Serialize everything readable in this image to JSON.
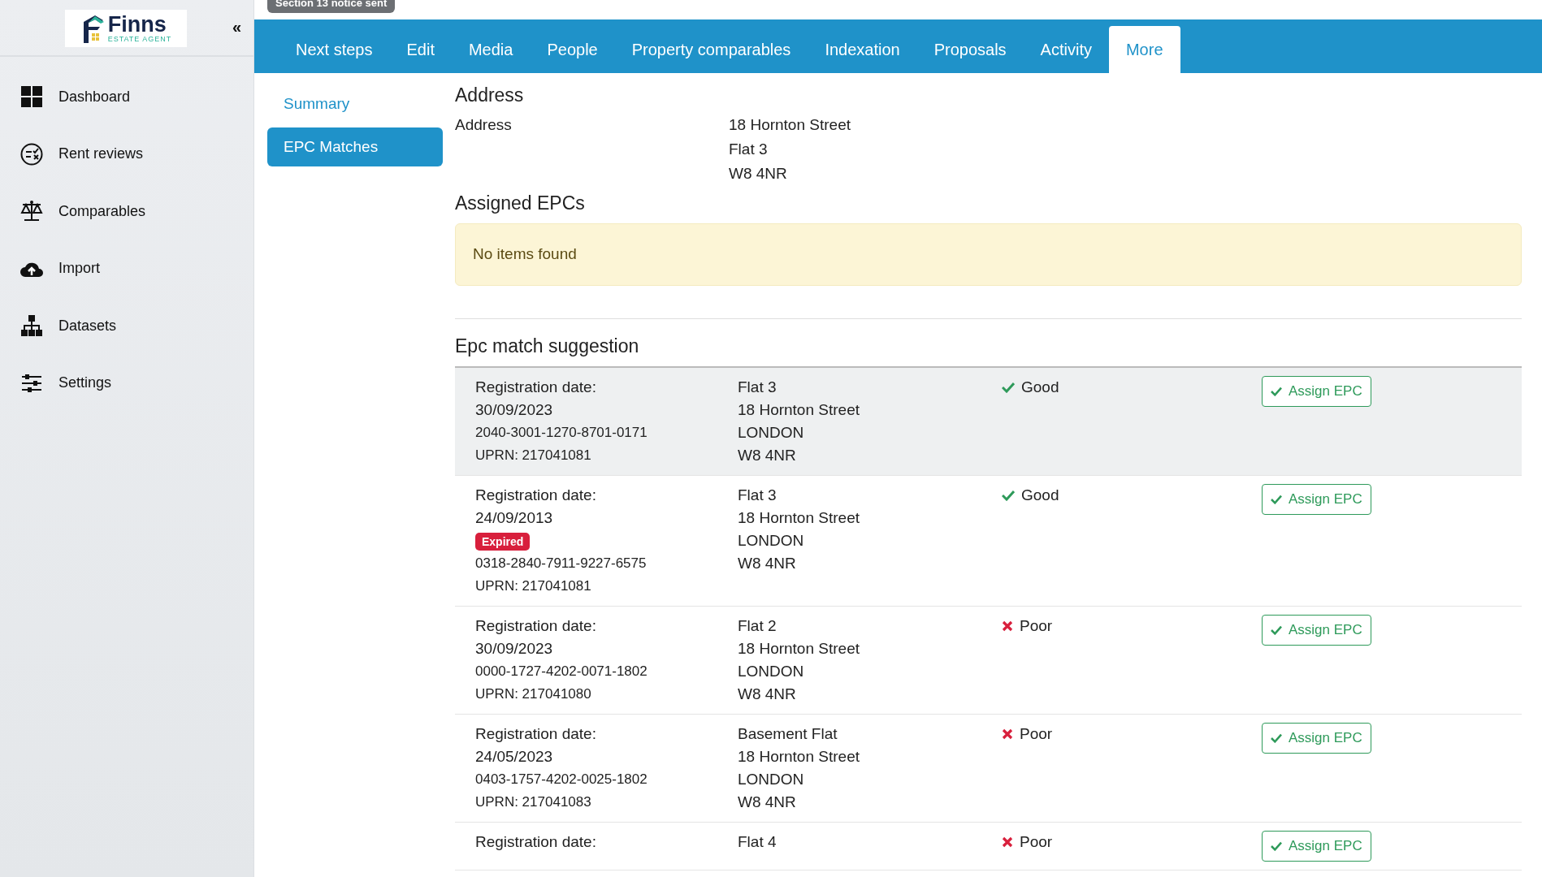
{
  "logo": {
    "name": "Finns",
    "tagline": "ESTATE AGENT"
  },
  "collapse_button": "«",
  "sidebar": {
    "items": [
      {
        "label": "Dashboard"
      },
      {
        "label": "Rent reviews"
      },
      {
        "label": "Comparables"
      },
      {
        "label": "Import"
      },
      {
        "label": "Datasets"
      },
      {
        "label": "Settings"
      }
    ]
  },
  "status_badge": "Section 13 notice sent",
  "tabs": [
    {
      "label": "Next steps",
      "selected": false
    },
    {
      "label": "Edit",
      "selected": false
    },
    {
      "label": "Media",
      "selected": false
    },
    {
      "label": "People",
      "selected": false
    },
    {
      "label": "Property comparables",
      "selected": false
    },
    {
      "label": "Indexation",
      "selected": false
    },
    {
      "label": "Proposals",
      "selected": false
    },
    {
      "label": "Activity",
      "selected": false
    },
    {
      "label": "More",
      "selected": true
    }
  ],
  "subnav": [
    {
      "label": "Summary",
      "selected": false
    },
    {
      "label": "EPC Matches",
      "selected": true
    }
  ],
  "address": {
    "heading": "Address",
    "label": "Address",
    "lines": [
      "18 Hornton Street",
      "Flat 3",
      "W8 4NR"
    ]
  },
  "assigned": {
    "heading": "Assigned EPCs",
    "empty_message": "No items found"
  },
  "suggestions": {
    "heading": "Epc match suggestion",
    "rows": [
      {
        "highlighted": true,
        "date_label": "Registration date:",
        "date": "30/09/2023",
        "certificate": "2040-3001-1270-8701-0171",
        "uprn": "UPRN: 217041081",
        "address_lines": [
          "Flat 3",
          "18 Hornton Street",
          "LONDON",
          "W8 4NR"
        ],
        "match": "Good",
        "match_ok": true,
        "button": "Assign EPC"
      },
      {
        "highlighted": false,
        "date_label": "Registration date:",
        "date": "24/09/2013",
        "badge": "Expired",
        "certificate": "0318-2840-7911-9227-6575",
        "uprn": "UPRN: 217041081",
        "address_lines": [
          "Flat 3",
          "18 Hornton Street",
          "LONDON",
          "W8 4NR"
        ],
        "match": "Good",
        "match_ok": true,
        "button": "Assign EPC"
      },
      {
        "highlighted": false,
        "date_label": "Registration date:",
        "date": "30/09/2023",
        "certificate": "0000-1727-4202-0071-1802",
        "uprn": "UPRN: 217041080",
        "address_lines": [
          "Flat 2",
          "18 Hornton Street",
          "LONDON",
          "W8 4NR"
        ],
        "match": "Poor",
        "match_ok": false,
        "button": "Assign EPC"
      },
      {
        "highlighted": false,
        "date_label": "Registration date:",
        "date": "24/05/2023",
        "certificate": "0403-1757-4202-0025-1802",
        "uprn": "UPRN: 217041083",
        "address_lines": [
          "Basement Flat",
          "18 Hornton Street",
          "LONDON",
          "W8 4NR"
        ],
        "match": "Poor",
        "match_ok": false,
        "button": "Assign EPC"
      },
      {
        "highlighted": false,
        "date_label": "Registration date:",
        "address_lines": [
          "Flat 4"
        ],
        "match": "Poor",
        "match_ok": false,
        "button": "Assign EPC"
      }
    ]
  }
}
